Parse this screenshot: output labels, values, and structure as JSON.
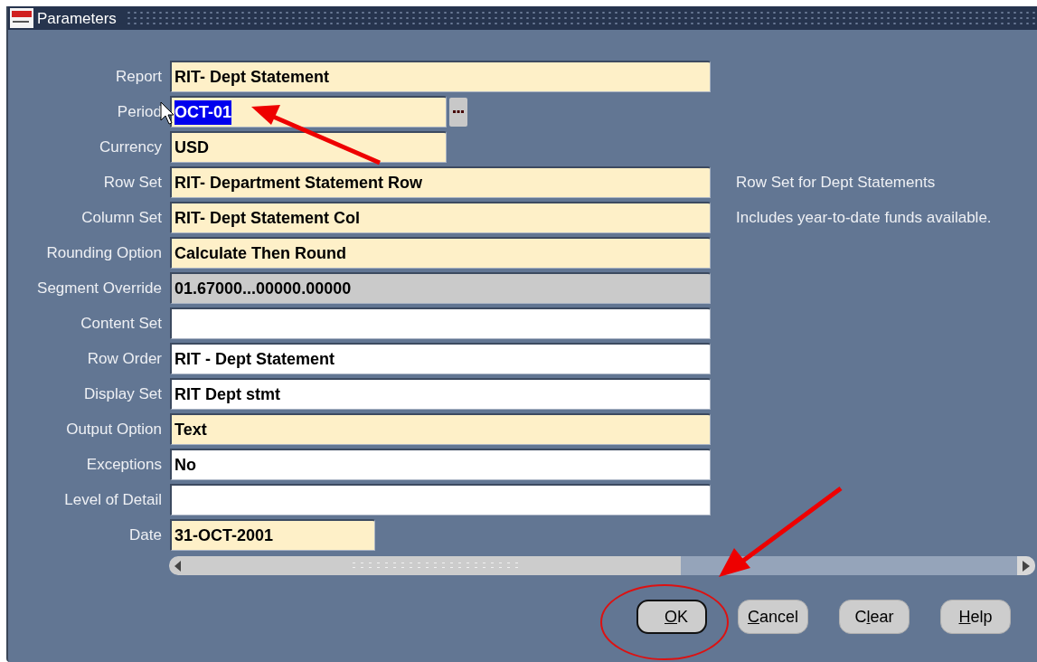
{
  "window": {
    "title": "Parameters"
  },
  "fields": [
    {
      "label": "Report",
      "value": "RIT- Dept Statement",
      "kind": "required",
      "text_selected": false,
      "list_button": false
    },
    {
      "label": "Period",
      "value": "OCT-01",
      "kind": "required",
      "text_selected": true,
      "list_button": true
    },
    {
      "label": "Currency",
      "value": "USD",
      "kind": "required",
      "text_selected": false,
      "list_button": false
    },
    {
      "label": "Row Set",
      "value": "RIT- Department Statement Row",
      "kind": "required",
      "text_selected": false,
      "list_button": false,
      "description": "Row Set for Dept Statements"
    },
    {
      "label": "Column Set",
      "value": "RIT- Dept Statement Col",
      "kind": "required",
      "text_selected": false,
      "list_button": false,
      "description": "Includes year-to-date funds available."
    },
    {
      "label": "Rounding Option",
      "value": "Calculate Then Round",
      "kind": "required",
      "text_selected": false,
      "list_button": false
    },
    {
      "label": "Segment Override",
      "value": "01.67000...00000.00000",
      "kind": "readonly",
      "text_selected": false,
      "list_button": false
    },
    {
      "label": "Content Set",
      "kind": "optional",
      "text_selected": false,
      "list_button": false
    },
    {
      "label": "Row Order",
      "value": "RIT - Dept Statement",
      "kind": "optional",
      "text_selected": false,
      "list_button": false
    },
    {
      "label": "Display Set",
      "value": "RIT Dept stmt",
      "kind": "optional",
      "text_selected": false,
      "list_button": false
    },
    {
      "label": "Output Option",
      "value": "Text",
      "kind": "required",
      "text_selected": false,
      "list_button": false
    },
    {
      "label": "Exceptions",
      "value": "No",
      "kind": "optional",
      "text_selected": false,
      "list_button": false
    },
    {
      "label": "Level of Detail",
      "kind": "optional",
      "text_selected": false,
      "list_button": false
    },
    {
      "label": "Date",
      "value": "31-OCT-2001",
      "kind": "required",
      "text_selected": false,
      "list_button": false
    }
  ],
  "buttons": [
    {
      "label": "OK",
      "default": true
    },
    {
      "label": "Cancel",
      "default": false
    },
    {
      "label": "Clear",
      "default": false
    },
    {
      "label": "Help",
      "default": false
    }
  ]
}
